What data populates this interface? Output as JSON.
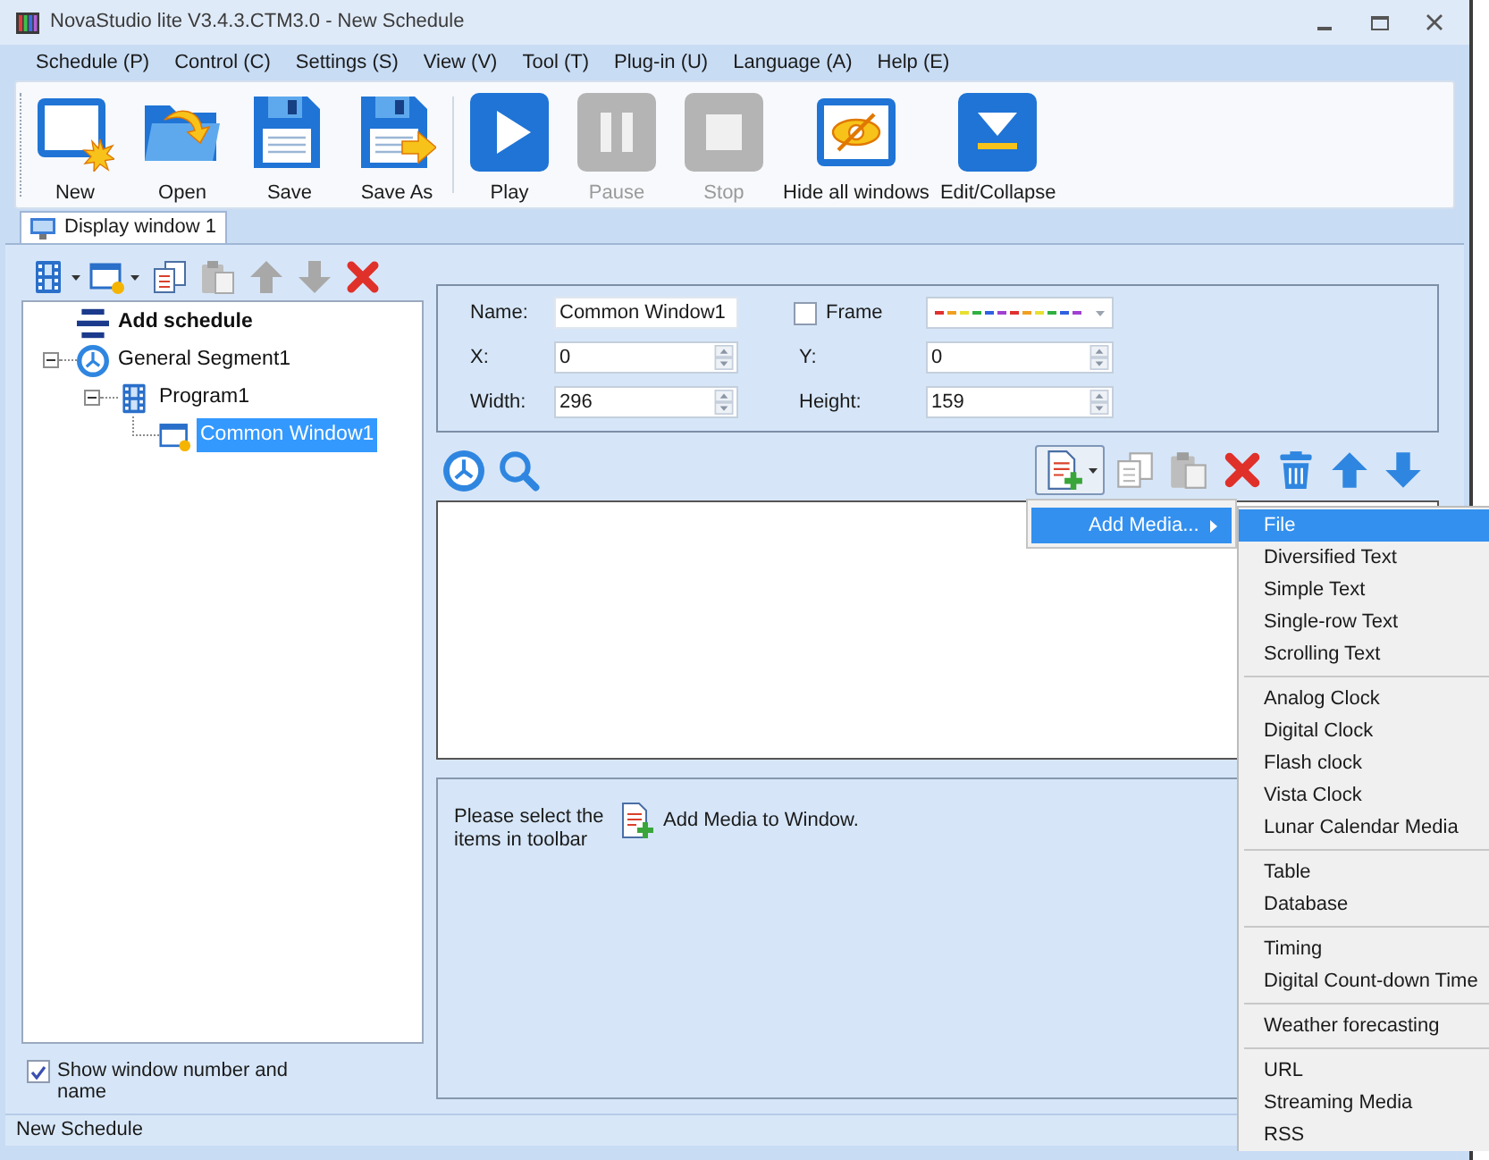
{
  "window": {
    "title": "NovaStudio lite V3.4.3.CTM3.0 - New Schedule"
  },
  "menu_bar": [
    "Schedule (P)",
    "Control (C)",
    "Settings (S)",
    "View (V)",
    "Tool (T)",
    "Plug-in (U)",
    "Language (A)",
    "Help (E)"
  ],
  "toolbar": {
    "groups": [
      {
        "buttons": [
          {
            "kind": "new",
            "label": "New",
            "disabled": false
          },
          {
            "kind": "open",
            "label": "Open",
            "disabled": false
          },
          {
            "kind": "save",
            "label": "Save",
            "disabled": false
          },
          {
            "kind": "save-as",
            "label": "Save As",
            "disabled": false
          }
        ]
      },
      {
        "buttons": [
          {
            "kind": "play",
            "label": "Play",
            "disabled": false
          },
          {
            "kind": "pause",
            "label": "Pause",
            "disabled": true
          },
          {
            "kind": "stop",
            "label": "Stop",
            "disabled": true
          },
          {
            "kind": "hide",
            "label": "Hide all windows",
            "disabled": false
          },
          {
            "kind": "collapse",
            "label": "Edit/Collapse",
            "disabled": false
          }
        ]
      }
    ]
  },
  "tabs": [
    {
      "label": "Display window 1",
      "selected": true
    }
  ],
  "tree_toolbar": [
    {
      "kind": "program",
      "dropdown": true,
      "disabled": false
    },
    {
      "kind": "window",
      "dropdown": true,
      "disabled": false
    },
    {
      "kind": "copy",
      "dropdown": false,
      "disabled": false
    },
    {
      "kind": "paste",
      "dropdown": false,
      "disabled": true
    },
    {
      "kind": "up",
      "dropdown": false,
      "disabled": true
    },
    {
      "kind": "down",
      "dropdown": false,
      "disabled": true
    },
    {
      "kind": "delete",
      "dropdown": false,
      "disabled": false
    }
  ],
  "tree": {
    "root": {
      "label": "Add schedule"
    },
    "items": [
      {
        "kind": "segment",
        "label": "General Segment1",
        "expanded": true,
        "selected": false,
        "children": [
          {
            "kind": "program",
            "label": "Program1",
            "expanded": true,
            "selected": false,
            "children": [
              {
                "kind": "window",
                "label": "Common Window1",
                "selected": true
              }
            ]
          }
        ]
      }
    ]
  },
  "show_window_number": {
    "label": "Show window number and name",
    "checked": true
  },
  "properties": {
    "name": {
      "label": "Name:",
      "value": "Common Window1"
    },
    "frame": {
      "label": "Frame",
      "checked": false
    },
    "x": {
      "label": "X:",
      "value": "0"
    },
    "y": {
      "label": "Y:",
      "value": "0"
    },
    "width": {
      "label": "Width:",
      "value": "296"
    },
    "height": {
      "label": "Height:",
      "value": "159"
    }
  },
  "media_toolbar": {
    "left": [
      {
        "kind": "clock"
      },
      {
        "kind": "search"
      }
    ],
    "right": [
      {
        "kind": "add-media",
        "dropdown": true,
        "pressed": true,
        "disabled": false
      },
      {
        "kind": "copy",
        "dropdown": false,
        "pressed": false,
        "disabled": true
      },
      {
        "kind": "paste",
        "dropdown": false,
        "pressed": false,
        "disabled": true
      },
      {
        "kind": "delete",
        "dropdown": false,
        "pressed": false,
        "disabled": false
      },
      {
        "kind": "trash",
        "dropdown": false,
        "pressed": false,
        "disabled": false
      },
      {
        "kind": "up",
        "dropdown": false,
        "pressed": false,
        "disabled": false
      },
      {
        "kind": "down",
        "dropdown": false,
        "pressed": false,
        "disabled": false
      }
    ]
  },
  "hint": {
    "text": "Please select the items in toolbar",
    "action": "Add Media to Window."
  },
  "context_menu": {
    "items": [
      {
        "label": "Add Media...",
        "selected": true,
        "submenu": true
      }
    ],
    "submenu_groups": [
      {
        "items": [
          {
            "label": "File",
            "selected": true
          },
          {
            "label": "Diversified Text",
            "selected": false
          },
          {
            "label": "Simple Text",
            "selected": false
          },
          {
            "label": "Single-row Text",
            "selected": false
          },
          {
            "label": "Scrolling Text",
            "selected": false
          }
        ]
      },
      {
        "items": [
          {
            "label": "Analog Clock",
            "selected": false
          },
          {
            "label": "Digital Clock",
            "selected": false
          },
          {
            "label": "Flash clock",
            "selected": false
          },
          {
            "label": "Vista Clock",
            "selected": false
          },
          {
            "label": "Lunar Calendar Media",
            "selected": false
          }
        ]
      },
      {
        "items": [
          {
            "label": "Table",
            "selected": false
          },
          {
            "label": "Database",
            "selected": false
          }
        ]
      },
      {
        "items": [
          {
            "label": "Timing",
            "selected": false
          },
          {
            "label": "Digital Count-down Time",
            "selected": false
          }
        ]
      },
      {
        "items": [
          {
            "label": "Weather forecasting",
            "selected": false
          }
        ]
      },
      {
        "items": [
          {
            "label": "URL",
            "selected": false
          },
          {
            "label": "Streaming Media",
            "selected": false
          },
          {
            "label": "RSS",
            "selected": false
          }
        ]
      }
    ]
  },
  "status_bar": "New Schedule"
}
